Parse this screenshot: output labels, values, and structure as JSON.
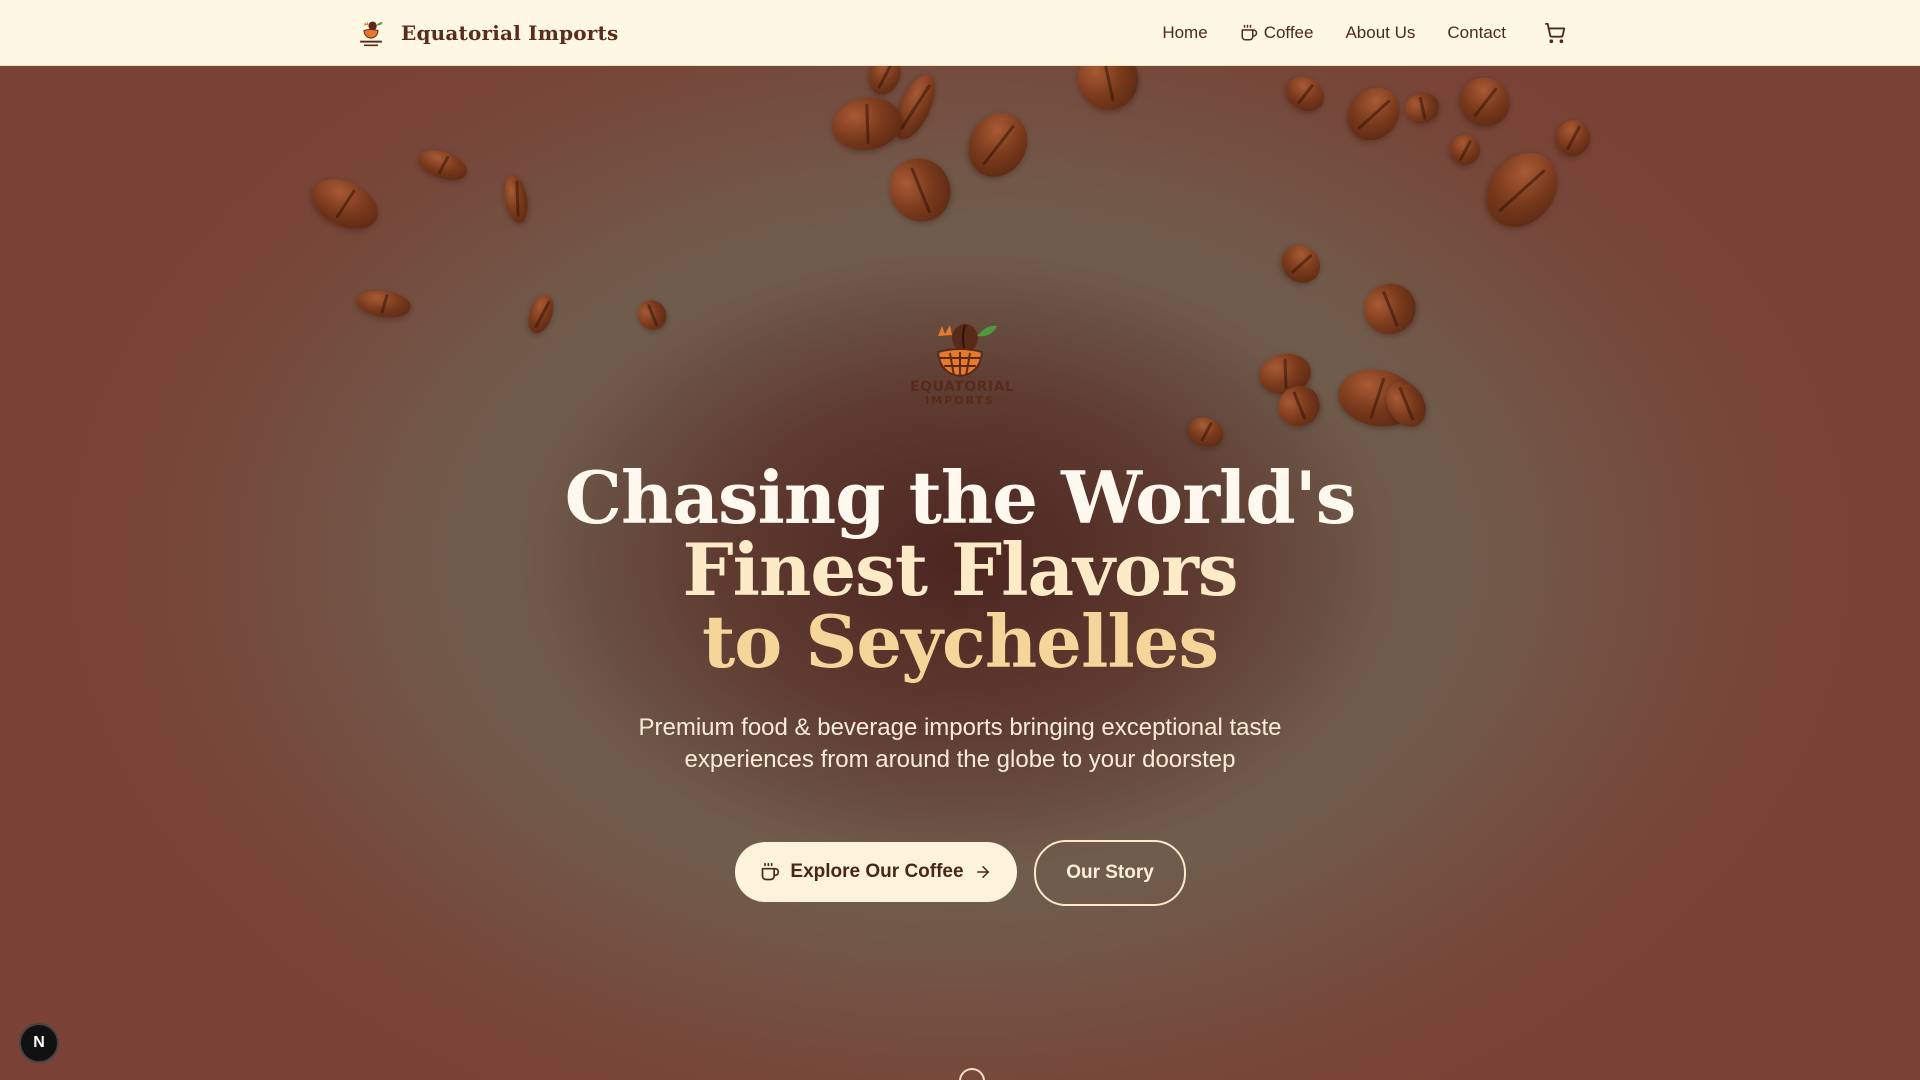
{
  "navbar": {
    "brand_name": "Equatorial Imports",
    "brand_logo_icon": "coffee-basket-logo-icon",
    "links": [
      {
        "label": "Home"
      },
      {
        "label": "Coffee",
        "icon": "coffee-cup-icon"
      },
      {
        "label": "About Us"
      },
      {
        "label": "Contact"
      }
    ],
    "cart_icon": "shopping-cart-icon"
  },
  "hero": {
    "logo_line1": "EQUATORIAL",
    "logo_line2": "IMPORTS",
    "headline_line1": "Chasing the World's",
    "headline_line2": "Finest Flavors",
    "headline_line3": "to Seychelles",
    "subtitle_line1": "Premium food & beverage imports bringing exceptional taste",
    "subtitle_line2": "experiences from around the globe to your doorstep",
    "primary_button": "Explore Our Coffee",
    "secondary_button": "Our Story"
  },
  "dev_badge": "N",
  "colors": {
    "navbar_bg": "#fdf7e4",
    "brand_text": "#5b2c1c",
    "headline_white": "#fff8ee",
    "headline_gold": "#f6d59a",
    "button_bg": "#fdf2da"
  }
}
